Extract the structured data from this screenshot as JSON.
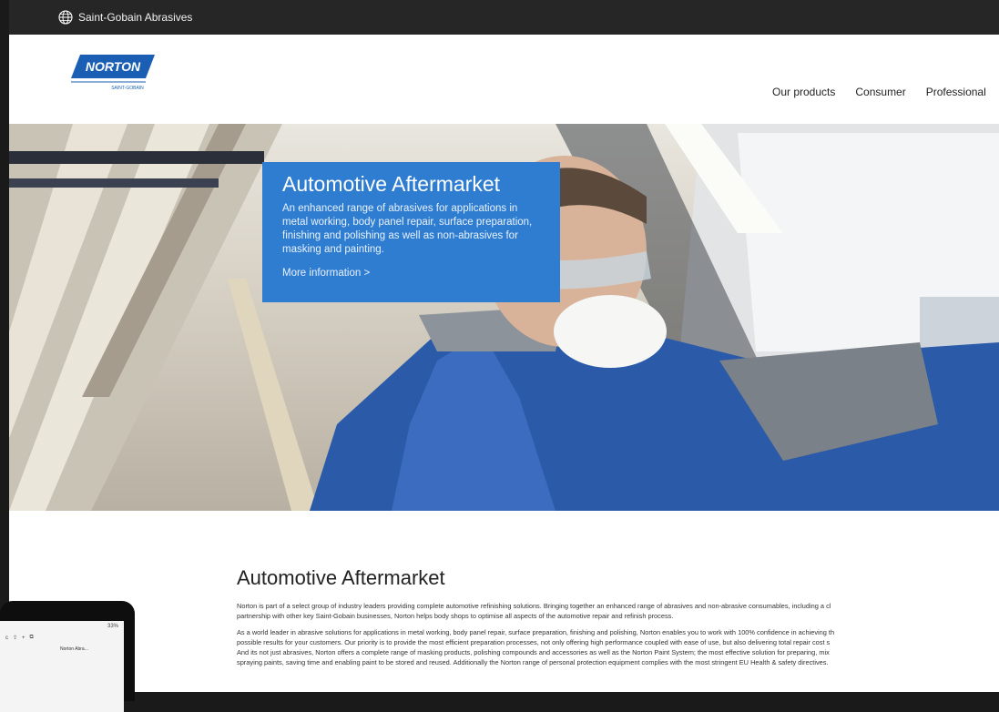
{
  "topbar": {
    "brand": "Saint-Gobain Abrasives"
  },
  "logo": {
    "name": "NORTON",
    "sub": "SAINT-GOBAIN"
  },
  "nav": [
    "Our products",
    "Consumer",
    "Professional"
  ],
  "hero": {
    "title": "Automotive Aftermarket",
    "description": "An enhanced range of abrasives for applications in metal working, body panel repair, surface preparation, finishing and polishing as well as non-abrasives for masking and painting.",
    "link": "More information >"
  },
  "content": {
    "title": "Automotive Aftermarket",
    "paragraphs": [
      "Norton is part of a select group of industry leaders providing complete automotive refinishing solutions. Bringing together an enhanced range of abrasives and non-abrasive consumables, including a cl",
      "partnership with other key Saint-Gobain businesses, Norton helps body shops to optimise all aspects of the automotive repair and refinish process.",
      "As a world leader in abrasive solutions for applications in metal working, body panel repair, surface preparation, finishing and polishing, Norton enables you to work with 100% confidence in achieving th",
      "possible results for your customers. Our priority is to provide the most efficient preparation processes, not only offering high performance coupled with ease of use, but also delivering total repair cost s",
      "And its not just abrasives, Norton offers a complete range of masking products, polishing compounds and accessories as well as the Norton Paint System; the most effective solution for preparing, mix",
      "spraying paints, saving time and enabling paint to be stored and reused. Additionally the Norton range of personal protection equipment complies with the most stringent EU Health & safety directives."
    ]
  },
  "tablet": {
    "status": "33%",
    "tab_title": "Norton Abra..."
  },
  "colors": {
    "accent": "#2f7dd1",
    "topbar": "#262626",
    "logo_blue": "#1a5fb4"
  }
}
